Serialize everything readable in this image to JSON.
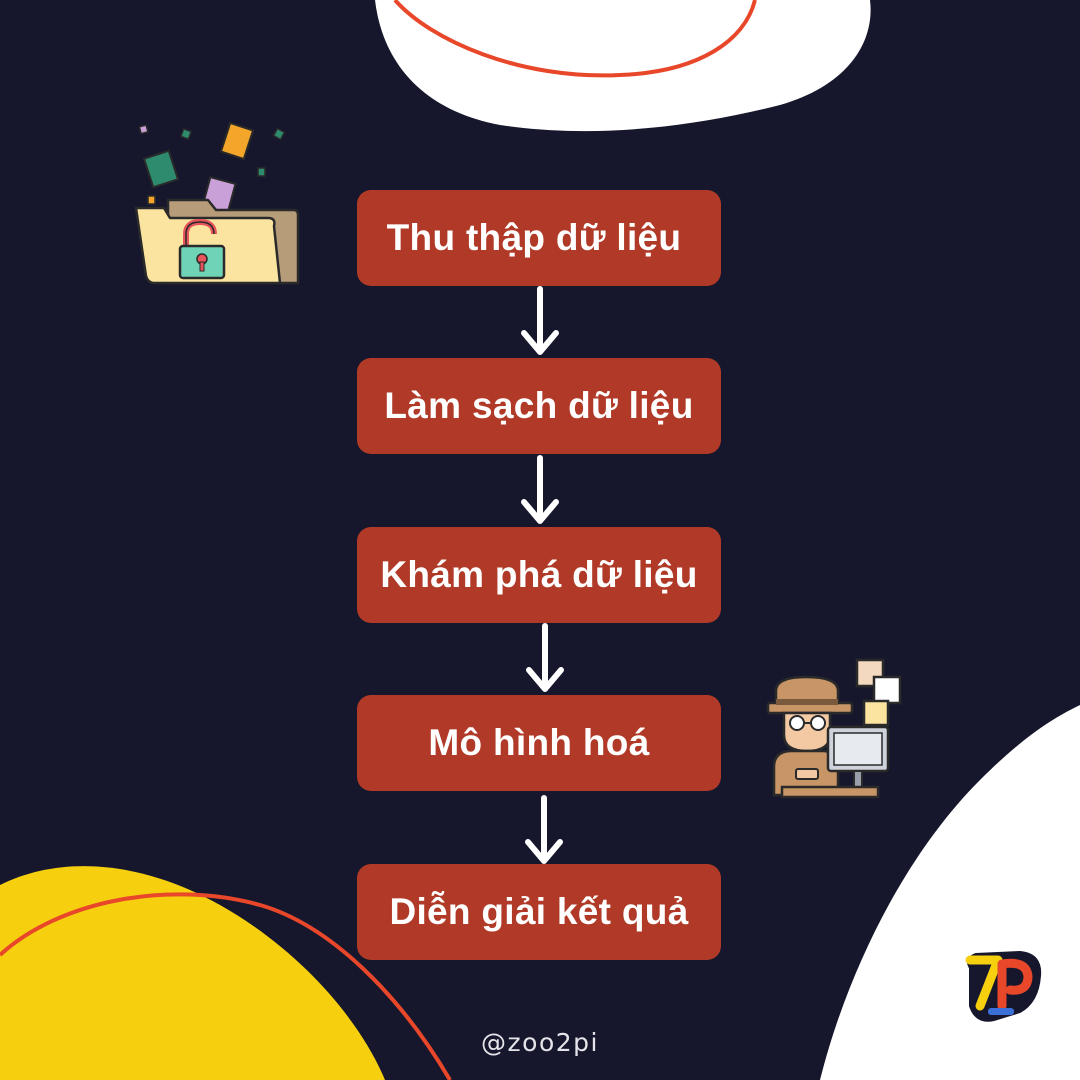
{
  "steps": [
    {
      "label": "Thu thập dữ liệu"
    },
    {
      "label": "Làm sạch dữ liệu"
    },
    {
      "label": "Khám phá dữ liệu"
    },
    {
      "label": "Mô hình hoá"
    },
    {
      "label": "Diễn giải kết quả"
    }
  ],
  "footer": {
    "handle": "@zoo2pi"
  },
  "logo": {
    "text": "7P"
  },
  "icons": {
    "top_left": "unlocked-folder-icon",
    "right": "detective-at-computer-icon",
    "arrow": "down-arrow-icon"
  },
  "colors": {
    "background": "#16172c",
    "step_box": "#b03a27",
    "accent_yellow": "#f6cf0e",
    "accent_orange_line": "#e8472a",
    "white_blob": "#ffffff"
  }
}
